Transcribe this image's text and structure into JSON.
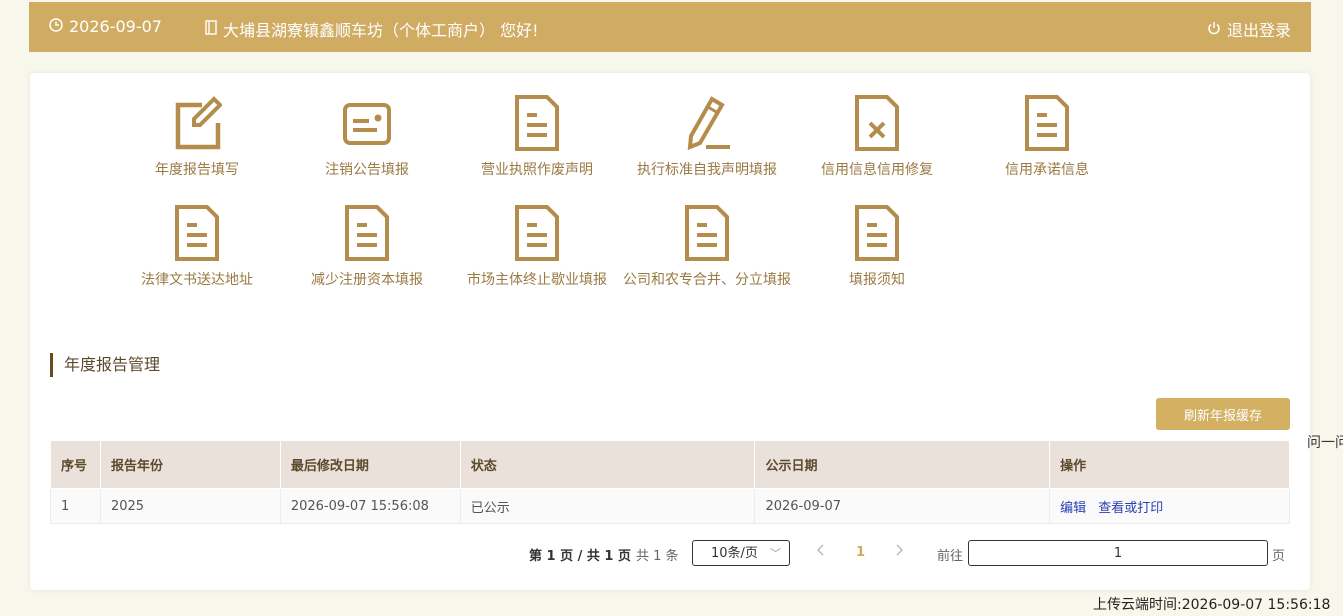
{
  "header": {
    "date": "2026-09-07",
    "greeting": "大埔县湖寮镇鑫顺车坊（个体工商户） 您好!",
    "logout_label": "退出登录"
  },
  "menu": {
    "items": [
      {
        "label": "年度报告填写",
        "icon": "edit-icon"
      },
      {
        "label": "注销公告填报",
        "icon": "id-card-icon"
      },
      {
        "label": "营业执照作废声明",
        "icon": "document-icon"
      },
      {
        "label": "执行标准自我声明填报",
        "icon": "pencil-icon"
      },
      {
        "label": "信用信息信用修复",
        "icon": "document-x-icon"
      },
      {
        "label": "信用承诺信息",
        "icon": "document-icon"
      },
      {
        "label": "法律文书送达地址",
        "icon": "document-icon"
      },
      {
        "label": "减少注册资本填报",
        "icon": "document-icon"
      },
      {
        "label": "市场主体终止歇业填报",
        "icon": "document-icon"
      },
      {
        "label": "公司和农专合并、分立填报",
        "icon": "document-icon"
      },
      {
        "label": "填报须知",
        "icon": "document-icon"
      }
    ]
  },
  "section": {
    "title": "年度报告管理",
    "refresh_label": "刷新年报缓存"
  },
  "table": {
    "headers": [
      "序号",
      "报告年份",
      "最后修改日期",
      "状态",
      "公示日期",
      "操作"
    ],
    "rows": [
      {
        "index": "1",
        "year": "2025",
        "modified": "2026-09-07 15:56:08",
        "status": "已公示",
        "publish_date": "2026-09-07",
        "action_edit": "编辑",
        "action_view": "查看或打印"
      }
    ]
  },
  "pagination": {
    "page_info": "第 1 页 / 共 1 页",
    "total": "共 1 条",
    "page_size": "10条/页",
    "current_page": "1",
    "goto_label": "前往",
    "goto_value": "1",
    "page_unit": "页"
  },
  "edge_text": "问一问",
  "upload_time": "上传云端时间:2026-09-07 15:56:18",
  "colors": {
    "header_bg": "#d0ab62",
    "accent": "#d4b062",
    "icon": "#b48c4c",
    "link": "#2a3fb0"
  }
}
